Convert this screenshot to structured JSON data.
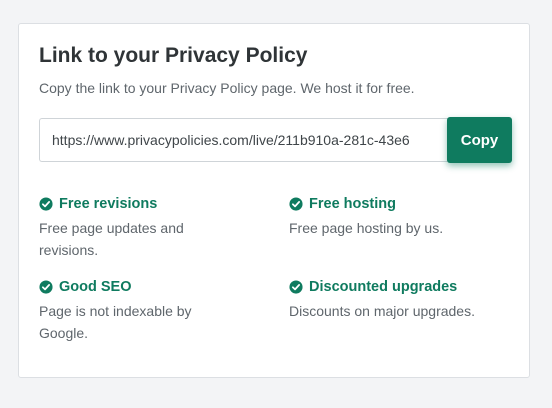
{
  "card": {
    "title": "Link to your Privacy Policy",
    "subtitle": "Copy the link to your Privacy Policy page. We host it for free."
  },
  "link": {
    "value": "https://www.privacypolicies.com/live/211b910a-281c-43e6",
    "copy_label": "Copy"
  },
  "features": [
    {
      "title": "Free revisions",
      "description": "Free page updates and revisions.",
      "icon": "check-circle-icon"
    },
    {
      "title": "Free hosting",
      "description": "Free page hosting by us.",
      "icon": "check-circle-icon"
    },
    {
      "title": "Good SEO",
      "description": "Page is not indexable by Google.",
      "icon": "check-circle-icon"
    },
    {
      "title": "Discounted upgrades",
      "description": "Discounts on major upgrades.",
      "icon": "check-circle-icon"
    }
  ],
  "colors": {
    "accent": "#0f7b5f",
    "text": "#2f3437",
    "muted": "#5f666c"
  }
}
